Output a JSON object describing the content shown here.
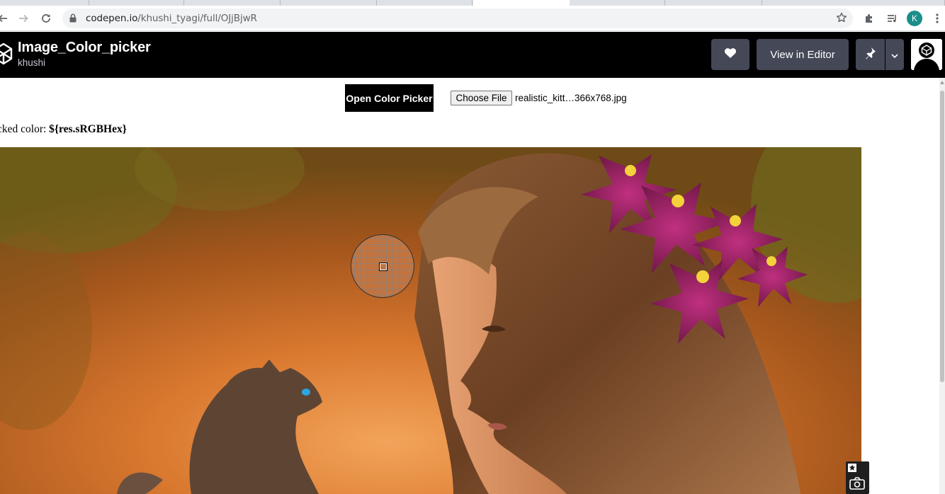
{
  "browser": {
    "url_host": "codepen.io",
    "url_path": "/khushi_tyagi/full/OJjBjwR",
    "profile_initial": "K",
    "icons": [
      "back-icon",
      "forward-icon",
      "reload-icon",
      "lock-icon",
      "bookmark-star-icon",
      "extensions-icon",
      "reading-list-icon",
      "kebab-menu-icon"
    ]
  },
  "header": {
    "title": "Image_Color_picker",
    "author": "khushi",
    "view_in_editor_label": "View in Editor",
    "icons": [
      "codepen-logo-icon",
      "heart-icon",
      "pin-icon",
      "chevron-down-icon",
      "user-avatar-icon"
    ]
  },
  "page": {
    "open_picker_label": "Open Color Picker",
    "choose_file_label": "Choose File",
    "file_name": "realistic_kitt…366x768.jpg",
    "picked_label": "cked color: ",
    "picked_value": "${res.sRGBHex}"
  },
  "colors": {
    "header_bg": "#000000",
    "button_bg": "#444857",
    "avatar_bg": "#1a8f8a",
    "loupe_color": "#c27440"
  }
}
